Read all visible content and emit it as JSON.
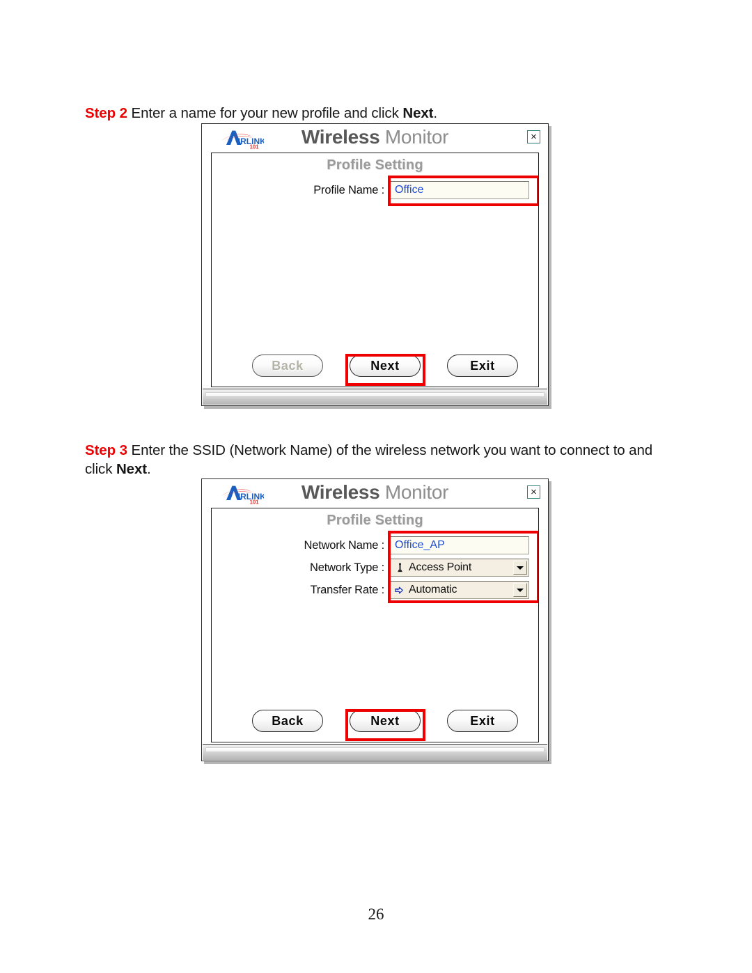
{
  "document": {
    "page_number": "26"
  },
  "steps": [
    {
      "label": "Step 2",
      "text_before": " Enter a name for your new profile and click ",
      "emphasis": "Next",
      "text_after": "."
    },
    {
      "label": "Step 3",
      "text_before": " Enter the SSID (Network Name) of the wireless network you want to connect to and click ",
      "emphasis": "Next",
      "text_after": "."
    }
  ],
  "dialog1": {
    "logo_alt": "AirLink 101",
    "title_bold": "Wireless",
    "title_light": " Monitor",
    "close_label": "×",
    "panel_title": "Profile Setting",
    "fields": [
      {
        "label": "Profile Name :",
        "value": "Office",
        "type": "text"
      }
    ],
    "buttons": [
      {
        "label": "Back",
        "state": "disabled"
      },
      {
        "label": "Next",
        "state": "enabled"
      },
      {
        "label": "Exit",
        "state": "enabled"
      }
    ],
    "highlighted": [
      "Profile Name :",
      "Next"
    ]
  },
  "dialog2": {
    "logo_alt": "AirLink 101",
    "title_bold": "Wireless",
    "title_light": " Monitor",
    "close_label": "×",
    "panel_title": "Profile Setting",
    "fields": [
      {
        "label": "Network Name :",
        "value": "Office_AP",
        "type": "text"
      },
      {
        "label": "Network Type :",
        "value": "Access Point",
        "type": "combo",
        "icon": "access-point-icon"
      },
      {
        "label": "Transfer Rate :",
        "value": "Automatic",
        "type": "combo",
        "icon": "transfer-rate-icon"
      }
    ],
    "buttons": [
      {
        "label": "Back",
        "state": "enabled"
      },
      {
        "label": "Next",
        "state": "enabled"
      },
      {
        "label": "Exit",
        "state": "enabled"
      }
    ],
    "highlighted": [
      "Network Name :",
      "Network Type :",
      "Transfer Rate :",
      "Next"
    ]
  },
  "colors": {
    "step_label_red": "#ee0000",
    "highlight_red": "#ee0000",
    "input_text_blue": "#1a49d6",
    "title_bold_gray": "#585858",
    "title_light_gray": "#8e8e8e",
    "panel_title_gray": "#9a9a9a",
    "close_border_teal": "#2d7d7d"
  }
}
